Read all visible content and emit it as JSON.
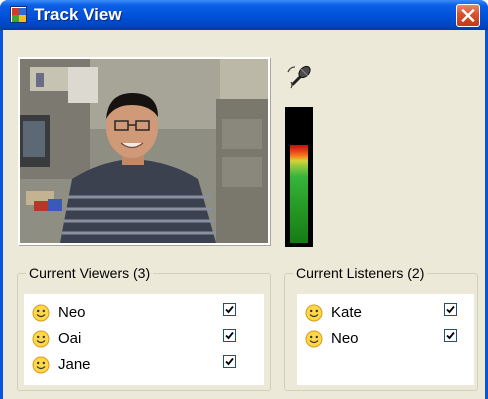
{
  "window": {
    "title": "Track View",
    "icon": "app-window-icon",
    "close_icon": "close-icon"
  },
  "video": {
    "icon": "video-frame",
    "description_icon": "person-video-icon"
  },
  "audio": {
    "mic_icon": "microphone-icon",
    "level_fraction": 0.72
  },
  "viewers": {
    "label": "Current Viewers (3)",
    "items": [
      {
        "name": "Neo",
        "checked": true
      },
      {
        "name": "Oai",
        "checked": true
      },
      {
        "name": "Jane",
        "checked": true
      }
    ]
  },
  "listeners": {
    "label": "Current Listeners (2)",
    "items": [
      {
        "name": "Kate",
        "checked": true
      },
      {
        "name": "Neo",
        "checked": true
      }
    ]
  },
  "colors": {
    "titlebar": "#0050d8",
    "client": "#ece9d8",
    "close_button": "#d6512e",
    "meter_green": "#2aa02a",
    "meter_red": "#bf1010"
  }
}
